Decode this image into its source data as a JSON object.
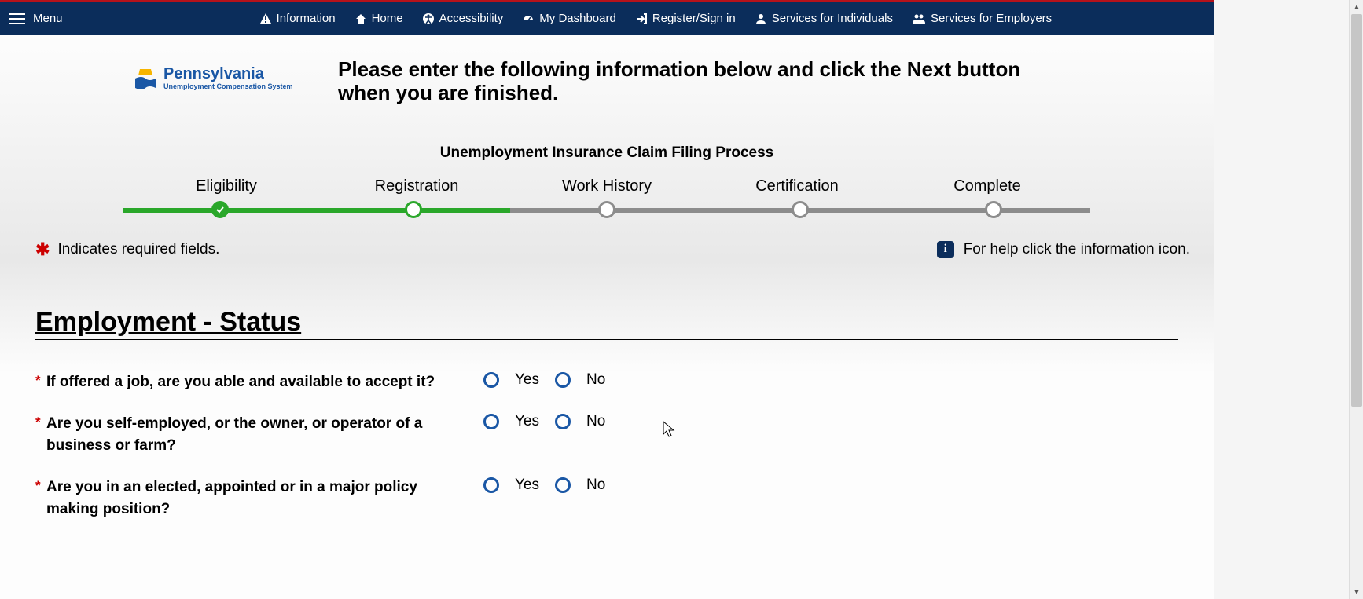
{
  "nav": {
    "menu": "Menu",
    "items": [
      {
        "label": "Information"
      },
      {
        "label": "Home"
      },
      {
        "label": "Accessibility"
      },
      {
        "label": "My Dashboard"
      },
      {
        "label": "Register/Sign in"
      },
      {
        "label": "Services for Individuals"
      },
      {
        "label": "Services for Employers"
      }
    ]
  },
  "logo": {
    "title": "Pennsylvania",
    "subtitle": "Unemployment Compensation System"
  },
  "instruction": "Please enter the following information below and click the Next button when you are finished.",
  "progress": {
    "title": "Unemployment Insurance Claim Filing Process",
    "steps": [
      "Eligibility",
      "Registration",
      "Work History",
      "Certification",
      "Complete"
    ]
  },
  "hints": {
    "required": "Indicates required fields.",
    "help": "For help click the information icon."
  },
  "section": {
    "title": "Employment - Status"
  },
  "options": {
    "yes": "Yes",
    "no": "No"
  },
  "questions": [
    {
      "text": "If offered a job, are you able and available to accept it?"
    },
    {
      "text": "Are you self-employed, or the owner, or operator of a business or farm?"
    },
    {
      "text": "Are you in an elected, appointed or in a major policy making position?"
    }
  ]
}
